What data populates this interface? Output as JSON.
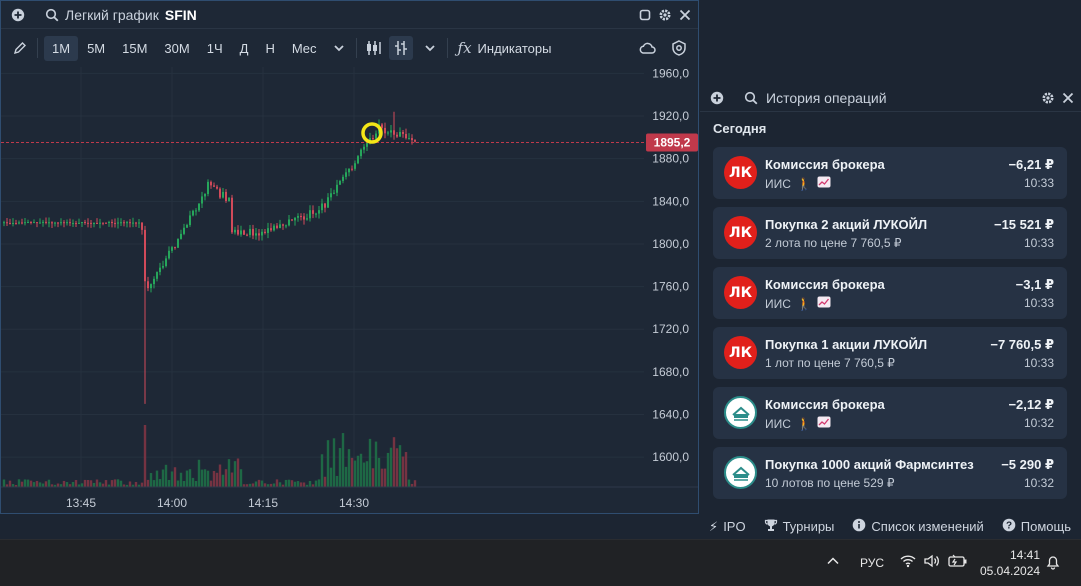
{
  "chart_window": {
    "title": "Легкий график",
    "ticker": "SFIN",
    "timeframes": [
      "1М",
      "5М",
      "15М",
      "30М",
      "1Ч",
      "Д",
      "Н",
      "Мес"
    ],
    "active_timeframe": 0,
    "indicators_label": "Индикаторы"
  },
  "chart_data": {
    "type": "candlestick",
    "x_ticks": [
      "13:45",
      "14:00",
      "14:15",
      "14:30"
    ],
    "y_ticks": [
      "1960,0",
      "1920,0",
      "1880,0",
      "1840,0",
      "1800,0",
      "1760,0",
      "1720,0",
      "1680,0",
      "1640,0",
      "1600,0"
    ],
    "ylim": [
      1572,
      1966
    ],
    "last_price": "1895,2",
    "last_price_value": 1895.2,
    "colors": {
      "up": "#26a65b",
      "down": "#d14a5a",
      "last_price": "#c0394b"
    }
  },
  "ops_panel": {
    "title": "История операций",
    "section": "Сегодня",
    "items": [
      {
        "logo": "ЛК",
        "logo_type": "luk",
        "name": "Комиссия брокера",
        "sub": "ИИС",
        "amount": "−6,21 ₽",
        "time": "10:33"
      },
      {
        "logo": "ЛК",
        "logo_type": "luk",
        "name": "Покупка 2 акций ЛУКОЙЛ",
        "sub": "2 лота по цене 7 760,5 ₽",
        "amount": "−15 521 ₽",
        "time": "10:33"
      },
      {
        "logo": "ЛК",
        "logo_type": "luk",
        "name": "Комиссия брокера",
        "sub": "ИИС",
        "amount": "−3,1 ₽",
        "time": "10:33"
      },
      {
        "logo": "ЛК",
        "logo_type": "luk",
        "name": "Покупка 1 акции ЛУКОЙЛ",
        "sub": "1 лот по цене 7 760,5 ₽",
        "amount": "−7 760,5 ₽",
        "time": "10:33"
      },
      {
        "logo": "",
        "logo_type": "farm",
        "name": "Комиссия брокера",
        "sub": "ИИС",
        "amount": "−2,12 ₽",
        "time": "10:32"
      },
      {
        "logo": "",
        "logo_type": "farm",
        "name": "Покупка 1000 акций Фармсинтез",
        "sub": "10 лотов по цене 529 ₽",
        "amount": "−5 290 ₽",
        "time": "10:32"
      }
    ]
  },
  "status_bar": {
    "items": [
      "IPO",
      "Турниры",
      "Список изменений",
      "Помощь"
    ]
  },
  "taskbar": {
    "lang": "РУС",
    "time": "14:41",
    "date": "05.04.2024"
  }
}
